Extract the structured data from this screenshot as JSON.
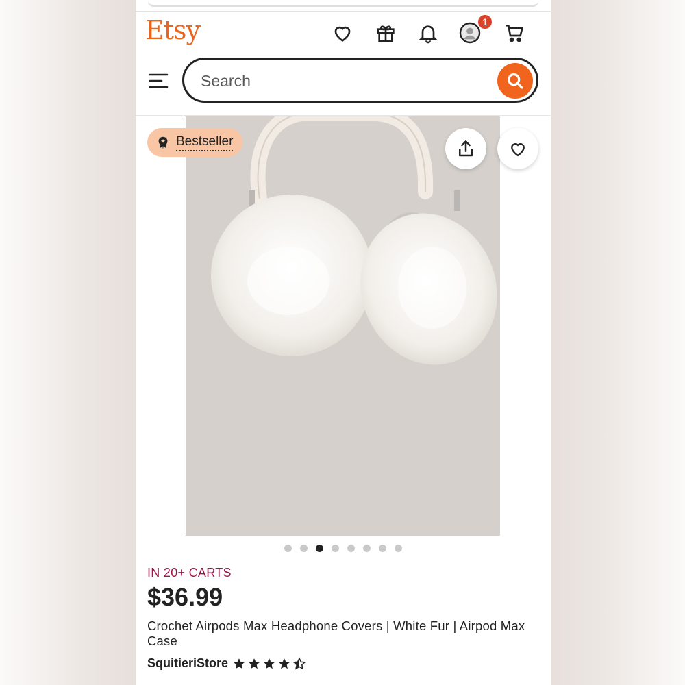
{
  "header": {
    "logo": "Etsy",
    "notification_count": "1",
    "icons": [
      "heart-icon",
      "gift-icon",
      "bell-icon",
      "account-icon",
      "cart-icon"
    ]
  },
  "search": {
    "placeholder": "Search",
    "value": ""
  },
  "listing": {
    "badge": "Bestseller",
    "image_count": 8,
    "active_image_index": 3,
    "carts_text": "IN 20+ CARTS",
    "price": "$36.99",
    "title": "Crochet Airpods Max Headphone Covers | White Fur | Airpod Max Case",
    "shop_name": "SquitieriStore",
    "rating": 4.5
  },
  "colors": {
    "brand": "#f1641e",
    "logo": "#e8661e",
    "carts": "#a3154a",
    "badge_bg": "#f8c6a4",
    "notification": "#d9432a"
  }
}
